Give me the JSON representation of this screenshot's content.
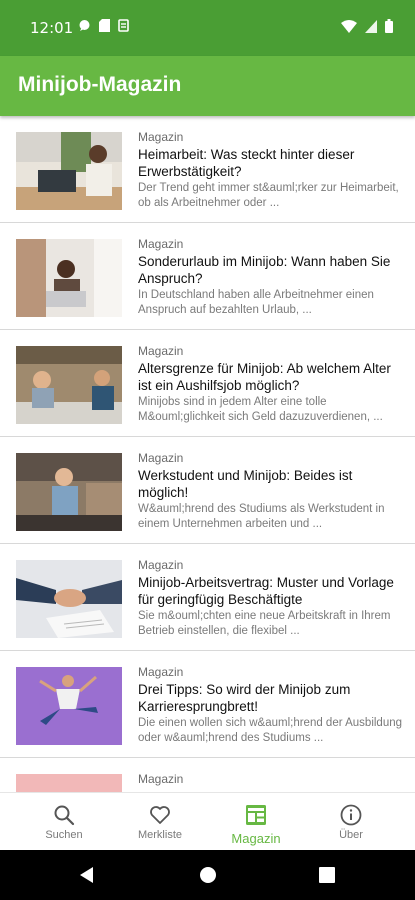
{
  "status_bar": {
    "time": "12:01"
  },
  "app_bar": {
    "title": "Minijob-Magazin"
  },
  "articles": [
    {
      "kicker": "Magazin",
      "title": "Heimarbeit: Was steckt hinter dieser Erwerbstätigkeit?",
      "teaser": "Der Trend geht immer st&auml;rker zur Heimarbeit, ob als Arbeitnehmer oder ..."
    },
    {
      "kicker": "Magazin",
      "title": "Sonderurlaub im Minijob: Wann haben Sie Anspruch?",
      "teaser": "In Deutschland haben alle Arbeitnehmer einen Anspruch auf bezahlten Urlaub, ..."
    },
    {
      "kicker": "Magazin",
      "title": "Altersgrenze für Minijob: Ab welchem Alter ist ein Aushilfsjob möglich?",
      "teaser": "Minijobs sind in jedem Alter eine tolle M&ouml;glichkeit sich Geld dazuzuverdienen, ..."
    },
    {
      "kicker": "Magazin",
      "title": "Werkstudent und Minijob: Beides ist möglich!",
      "teaser": "W&auml;hrend des Studiums als Werkstudent in einem Unternehmen arbeiten und ..."
    },
    {
      "kicker": "Magazin",
      "title": "Minijob-Arbeitsvertrag: Muster und Vorlage für geringfügig Beschäftigte",
      "teaser": "Sie m&ouml;chten eine neue Arbeitskraft in Ihrem Betrieb einstellen, die flexibel ..."
    },
    {
      "kicker": "Magazin",
      "title": "Drei Tipps: So wird der Minijob zum Karrieresprungbrett!",
      "teaser": "Die einen wollen sich w&auml;hrend der Ausbildung oder w&auml;hrend des Studiums ..."
    },
    {
      "kicker": "Magazin",
      "title": "",
      "teaser": ""
    }
  ],
  "bottom_nav": {
    "search_label": "Suchen",
    "watchlist_label": "Merkliste",
    "magazine_label": "Magazin",
    "about_label": "Über"
  },
  "colors": {
    "status_bar": "#4a9e34",
    "app_bar": "#67b843",
    "accent": "#67b843"
  }
}
